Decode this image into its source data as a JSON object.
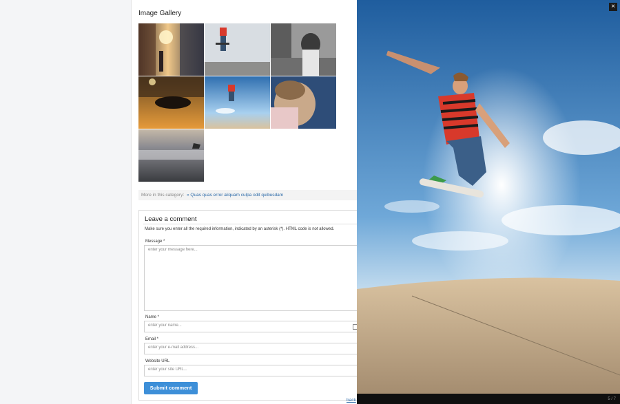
{
  "gallery": {
    "title": "Image Gallery",
    "thumbnails": [
      {
        "id": "thumb-street-sunset"
      },
      {
        "id": "thumb-skater-standing"
      },
      {
        "id": "thumb-woman-street"
      },
      {
        "id": "thumb-dog-floor"
      },
      {
        "id": "thumb-skater-jump"
      },
      {
        "id": "thumb-woman-hair"
      },
      {
        "id": "thumb-seascape"
      }
    ]
  },
  "more_in_category": {
    "label": "More in this category:",
    "link": "« Quas quas error aliquam culpa odit quibusdam"
  },
  "comment_form": {
    "title": "Leave a comment",
    "note": "Make sure you enter all the required information, indicated by an asterisk (*). HTML code is not allowed.",
    "message_label": "Message *",
    "message_placeholder": "enter your message here...",
    "name_label": "Name *",
    "name_placeholder": "enter your name...",
    "email_label": "Email *",
    "email_placeholder": "enter your e-mail address...",
    "url_label": "Website URL",
    "url_placeholder": "enter your site URL...",
    "submit_label": "Submit comment"
  },
  "footer": {
    "back_link": "back"
  },
  "lightbox": {
    "close_label": "×",
    "counter": "5 / 7"
  },
  "colors": {
    "accent": "#3d8fd8",
    "link": "#2c6aa8",
    "lightbox_bg": "#0f0f0f"
  }
}
